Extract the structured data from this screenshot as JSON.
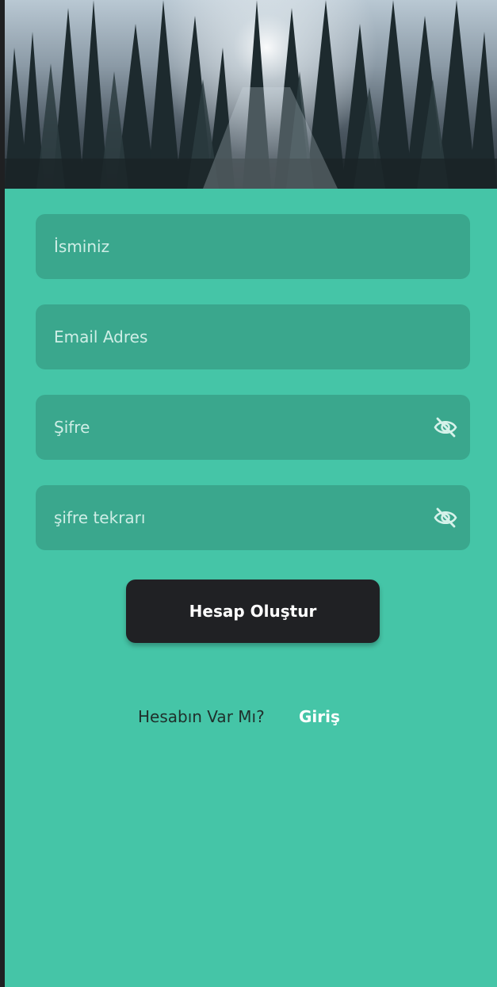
{
  "form": {
    "name_placeholder": "İsminiz",
    "email_placeholder": "Email Adres",
    "password_placeholder": "Şifre",
    "password_repeat_placeholder": "şifre tekrarı"
  },
  "actions": {
    "create_account_label": "Hesap Oluştur"
  },
  "footer": {
    "question": "Hesabın Var Mı?",
    "login_link": "Giriş"
  },
  "icons": {
    "password_toggle": "eye-off-icon",
    "password_repeat_toggle": "eye-off-icon"
  },
  "colors": {
    "background": "#45c5a7",
    "field": "#3aa78d",
    "button": "#202124",
    "button_text": "#ffffff"
  }
}
